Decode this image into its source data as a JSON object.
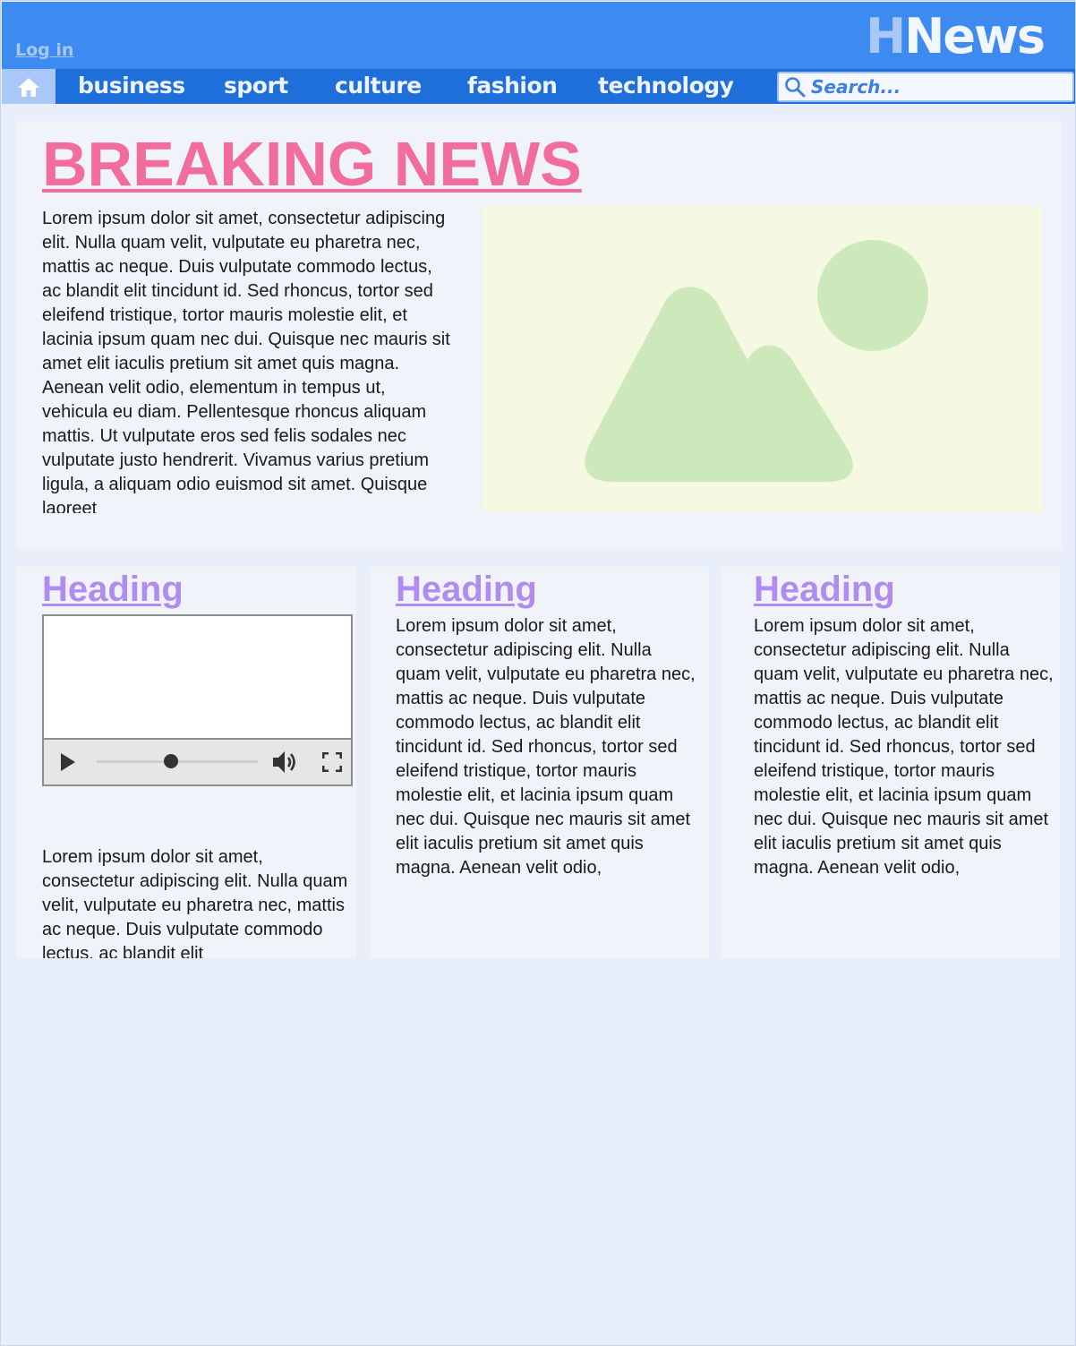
{
  "header": {
    "login_label": "Log in",
    "logo_first": "H",
    "logo_rest": "News"
  },
  "nav": {
    "home_icon": "home-icon",
    "items": [
      {
        "label": "business"
      },
      {
        "label": "sport"
      },
      {
        "label": "culture"
      },
      {
        "label": "fashion"
      },
      {
        "label": "technology"
      }
    ],
    "search_placeholder": "Search..."
  },
  "breaking": {
    "title": "BREAKING NEWS",
    "body": "Lorem ipsum dolor sit amet, consectetur adipiscing elit. Nulla quam velit, vulputate eu pharetra nec, mattis ac neque. Duis vulputate commodo lectus, ac blandit elit tincidunt id. Sed rhoncus, tortor sed eleifend tristique, tortor mauris molestie elit, et lacinia ipsum quam nec dui. Quisque nec mauris sit amet elit iaculis pretium sit amet quis magna. Aenean velit odio, elementum in tempus ut, vehicula eu diam. Pellentesque rhoncus aliquam mattis. Ut vulputate eros sed felis sodales nec vulputate justo hendrerit. Vivamus varius pretium ligula, a aliquam odio euismod sit amet. Quisque laoreet",
    "image_icon": "image-placeholder-icon"
  },
  "columns": [
    {
      "heading": "Heading",
      "video_progress": 0.46,
      "body": "Lorem ipsum dolor sit amet, consectetur adipiscing elit. Nulla quam velit, vulputate eu pharetra nec, mattis ac neque. Duis vulputate commodo lectus, ac blandit elit"
    },
    {
      "heading": "Heading",
      "body": "Lorem ipsum dolor sit amet, consectetur adipiscing elit. Nulla quam velit, vulputate eu pharetra nec, mattis ac neque. Duis vulputate commodo lectus, ac blandit elit tincidunt id. Sed rhoncus, tortor sed eleifend tristique, tortor mauris molestie elit, et lacinia ipsum quam nec dui. Quisque nec mauris sit amet elit iaculis pretium sit amet quis magna. Aenean velit odio,"
    },
    {
      "heading": "Heading",
      "body": "Lorem ipsum dolor sit amet, consectetur adipiscing elit. Nulla quam velit, vulputate eu pharetra nec, mattis ac neque. Duis vulputate commodo lectus, ac blandit elit tincidunt id. Sed rhoncus, tortor sed eleifend tristique, tortor mauris molestie elit, et lacinia ipsum quam nec dui. Quisque nec mauris sit amet elit iaculis pretium sit amet quis magna. Aenean velit odio,"
    }
  ],
  "colors": {
    "header_bg": "#3d8af1",
    "nav_bg": "#1e6fd9",
    "breaking_title": "#f06d9c",
    "column_heading": "#b18cf0",
    "image_placeholder_bg": "#f6f9e1",
    "image_placeholder_shape": "#cde9bc"
  }
}
